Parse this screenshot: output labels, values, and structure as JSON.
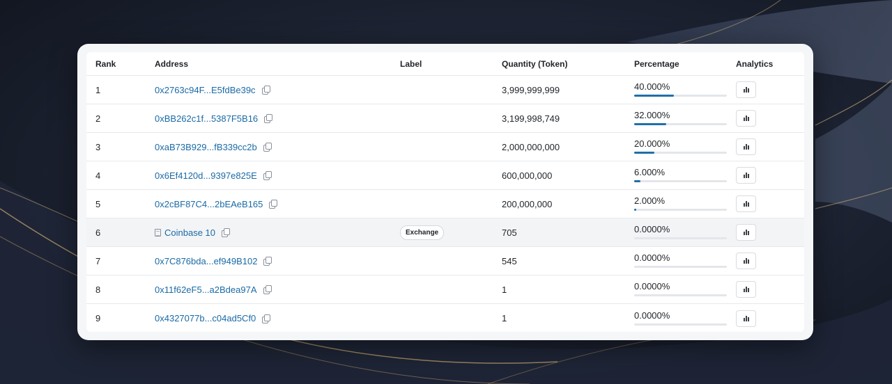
{
  "colors": {
    "background": "#1a2030",
    "accent": "#1f6fa8",
    "link": "#1a6aa6"
  },
  "table": {
    "headers": {
      "rank": "Rank",
      "address": "Address",
      "label": "Label",
      "quantity": "Quantity (Token)",
      "percentage": "Percentage",
      "analytics": "Analytics"
    },
    "rows": [
      {
        "rank": "1",
        "address": "0x2763c94F...E5fdBe39c",
        "label": "",
        "quantity": "3,999,999,999",
        "percentage": "40.000%",
        "share": 0.4
      },
      {
        "rank": "2",
        "address": "0xBB262c1f...5387F5B16",
        "label": "",
        "quantity": "3,199,998,749",
        "percentage": "32.000%",
        "share": 0.32
      },
      {
        "rank": "3",
        "address": "0xaB73B929...fB339cc2b",
        "label": "",
        "quantity": "2,000,000,000",
        "percentage": "20.000%",
        "share": 0.2
      },
      {
        "rank": "4",
        "address": "0x6Ef4120d...9397e825E",
        "label": "",
        "quantity": "600,000,000",
        "percentage": "6.000%",
        "share": 0.06
      },
      {
        "rank": "5",
        "address": "0x2cBF87C4...2bEAeB165",
        "label": "",
        "quantity": "200,000,000",
        "percentage": "2.000%",
        "share": 0.02
      },
      {
        "rank": "6",
        "address": "Coinbase 10",
        "label": "Exchange",
        "quantity": "705",
        "percentage": "0.0000%",
        "share": 0,
        "named": true
      },
      {
        "rank": "7",
        "address": "0x7C876bda...ef949B102",
        "label": "",
        "quantity": "545",
        "percentage": "0.0000%",
        "share": 0
      },
      {
        "rank": "8",
        "address": "0x11f62eF5...a2Bdea97A",
        "label": "",
        "quantity": "1",
        "percentage": "0.0000%",
        "share": 0
      },
      {
        "rank": "9",
        "address": "0x4327077b...c04ad5Cf0",
        "label": "",
        "quantity": "1",
        "percentage": "0.0000%",
        "share": 0
      }
    ]
  }
}
